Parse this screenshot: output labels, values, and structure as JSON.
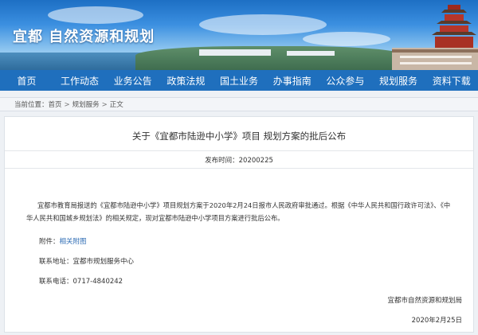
{
  "site": {
    "title": "宜都 自然资源和规划"
  },
  "nav": {
    "items": [
      "首页",
      "工作动态",
      "业务公告",
      "政策法规",
      "国土业务",
      "办事指南",
      "公众参与",
      "规划服务",
      "资料下载"
    ]
  },
  "breadcrumb": {
    "label": "当前位置：",
    "items": [
      "首页",
      "规划服务",
      "正文"
    ]
  },
  "article": {
    "title": "关于《宜都市陆逊中小学》项目 规划方案的批后公布",
    "publish_label": "发布时间：",
    "publish_date": "20200225",
    "body": "宜都市教育局报送的《宜都市陆逊中小学》项目规划方案于2020年2月24日报市人民政府审批通过。根据《中华人民共和国行政许可法》、《中华人民共和国城乡规划法》的相关规定，现对宜都市陆逊中小学项目方案进行批后公布。",
    "attachment_label": "附件：",
    "attachment_link": "相关附图",
    "contact_address_label": "联系地址：",
    "contact_address": "宜都市规划服务中心",
    "contact_phone_label": "联系电话：",
    "contact_phone": "0717-4840242",
    "signature_org": "宜都市自然资源和规划局",
    "signature_date": "2020年2月25日"
  },
  "colors": {
    "nav_bg": "#1f6fbd",
    "link": "#2f6db5",
    "banner_sky": "#3b8fe0"
  }
}
